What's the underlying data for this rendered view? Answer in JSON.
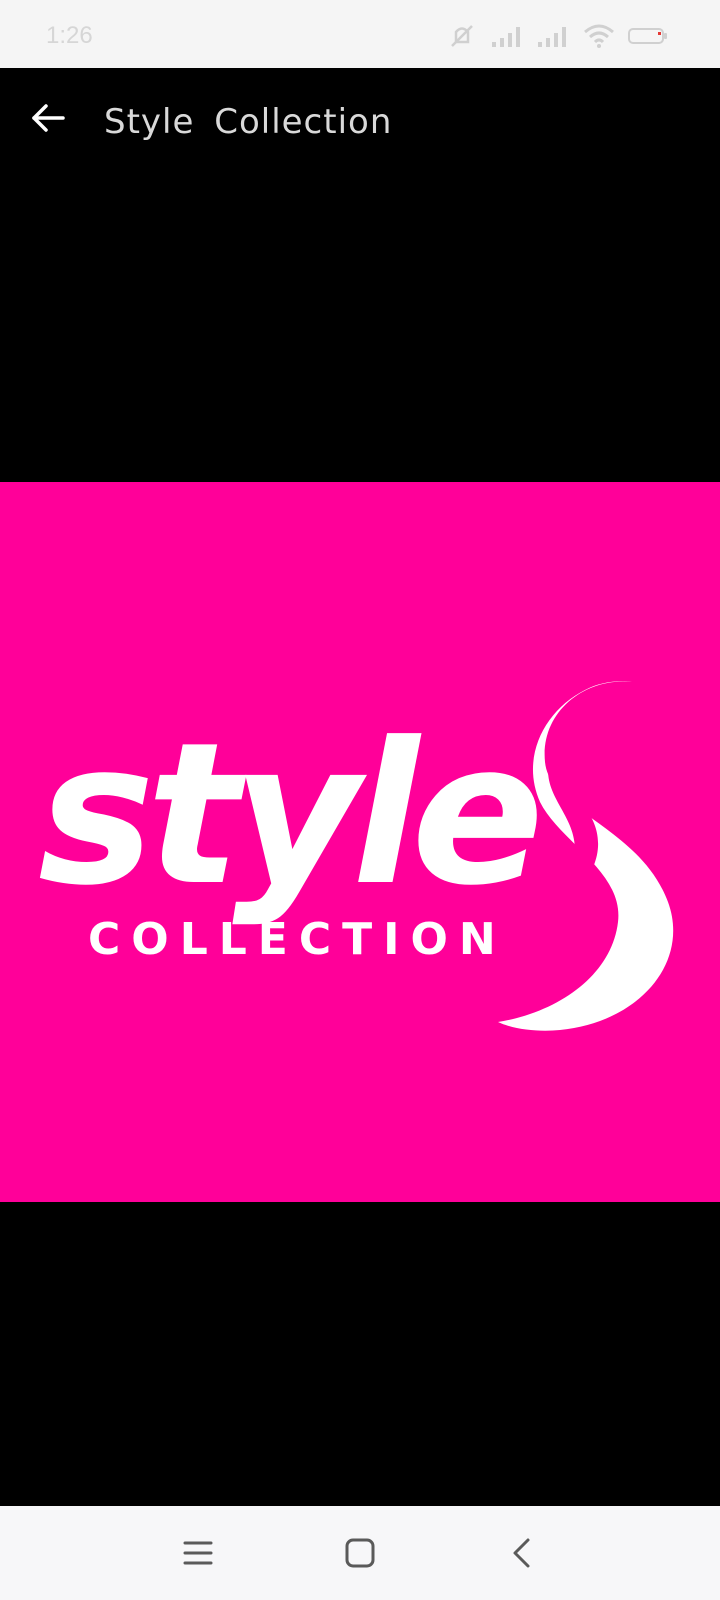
{
  "status_bar": {
    "time": "1:26",
    "icons": [
      "mute-icon",
      "signal-icon",
      "signal-icon",
      "wifi-icon",
      "battery-icon"
    ]
  },
  "app_bar": {
    "title": "Style  Collection",
    "back_icon": "arrow-left-icon"
  },
  "image": {
    "logo_wordmark": "style",
    "logo_subtitle": "COLLECTION",
    "background_color": "#ff0099",
    "logo_color": "#ffffff"
  },
  "nav_bar": {
    "icons": [
      "menu-icon",
      "home-square-icon",
      "back-chevron-icon"
    ]
  },
  "colors": {
    "status_bar_bg": "#f5f5f5",
    "app_bg": "#000000",
    "title_text": "#d9d9d9",
    "nav_bar_bg": "#f7f7f9",
    "nav_icon": "#5a5a5a"
  }
}
